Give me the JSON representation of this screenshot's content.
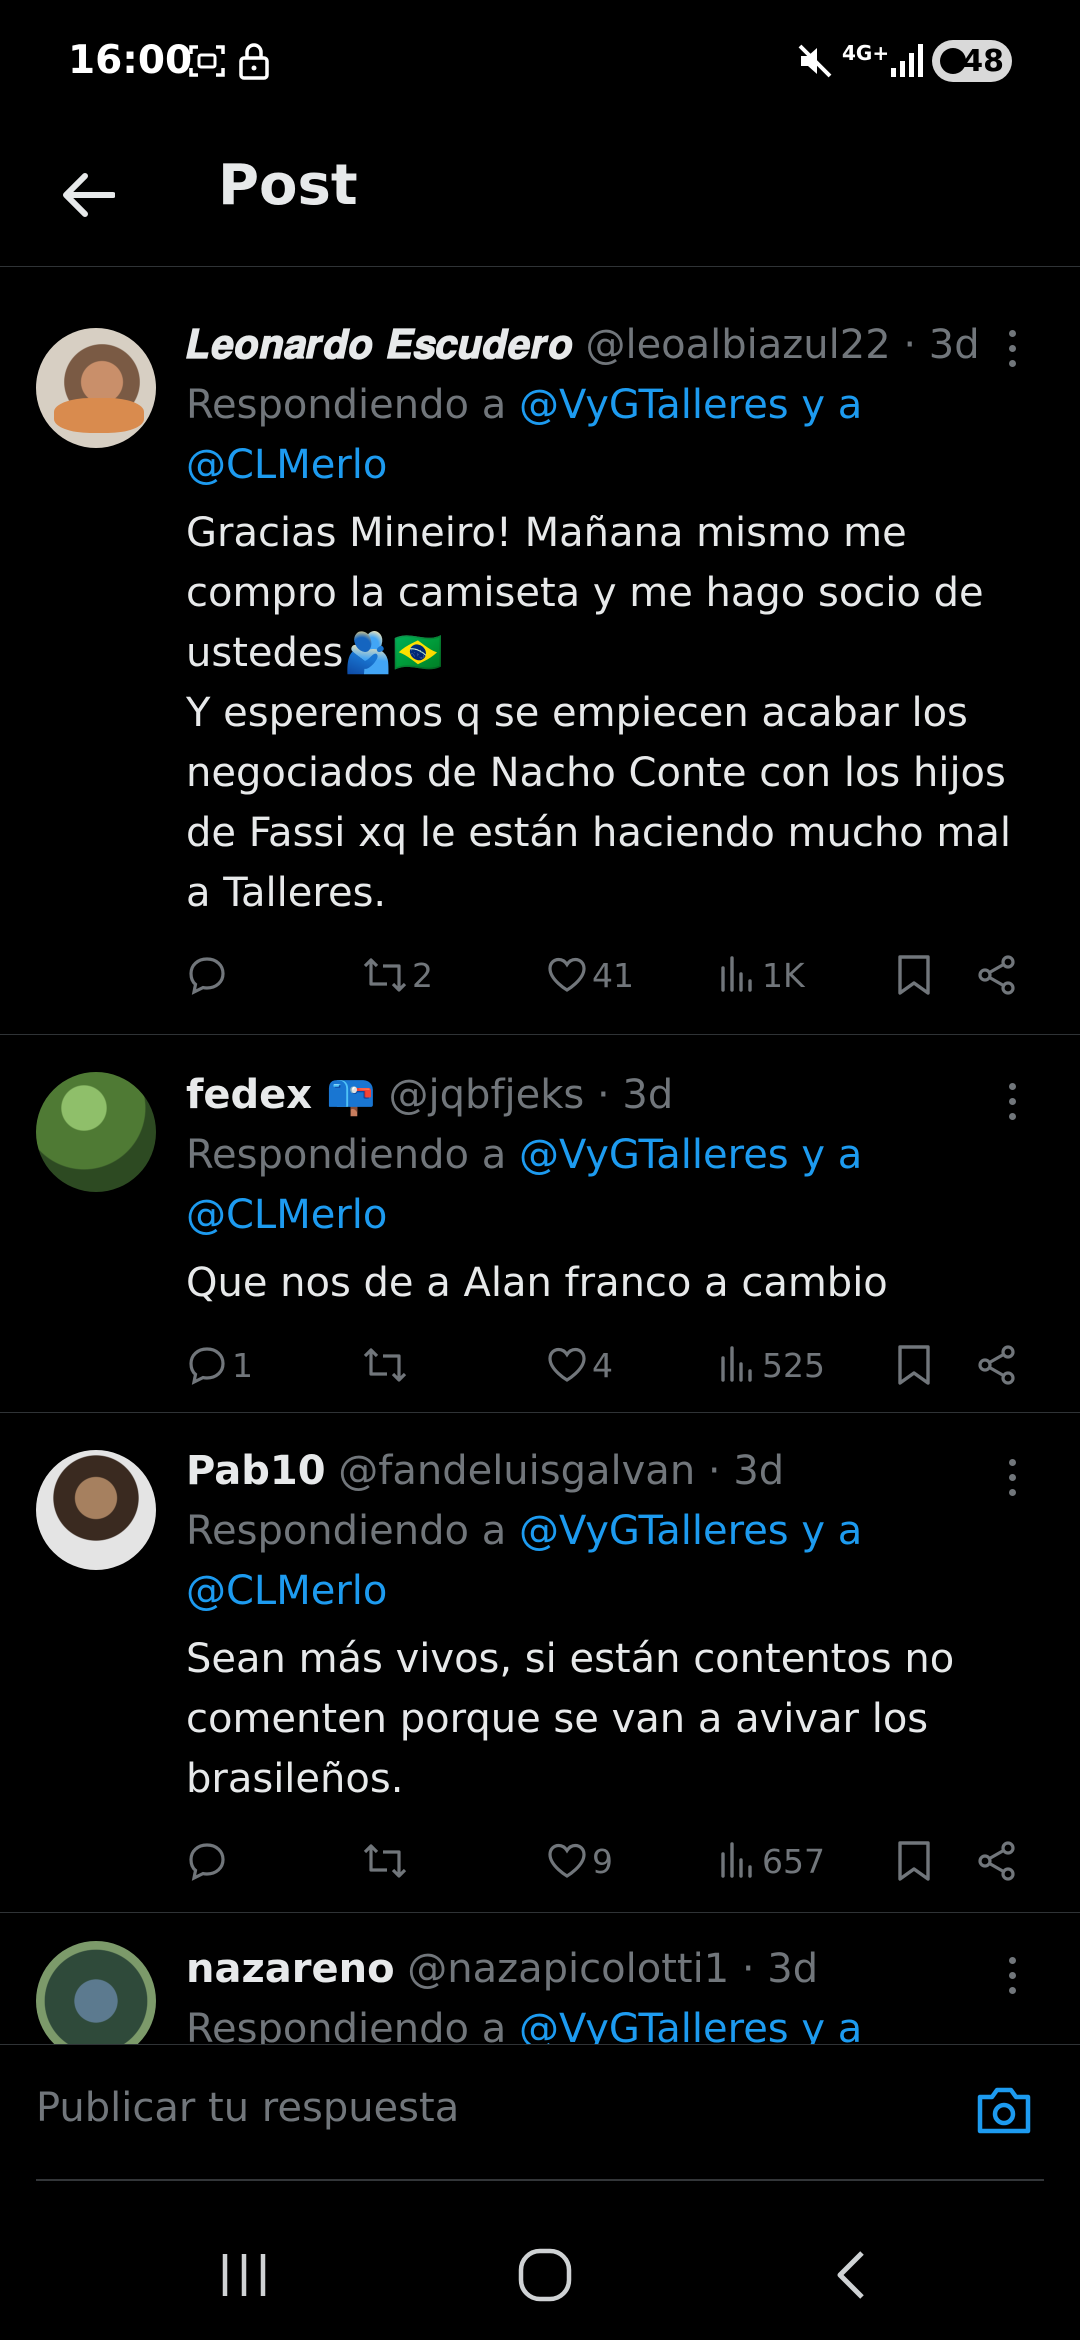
{
  "status_bar": {
    "time": "16:00",
    "network": "4G+",
    "battery": "48"
  },
  "header": {
    "title": "Post"
  },
  "tweets": [
    {
      "name": "𝑳𝒆𝒐𝒏𝒂𝒓𝒅𝒐 𝑬𝒔𝒄𝒖𝒅𝒆𝒓𝒐",
      "handle": "@leoalbiazul22",
      "time": "· 3d",
      "reply_prefix": "Respondiendo a ",
      "reply_to_1": "@VyGTalleres y a",
      "reply_to_2": "@CLMerlo",
      "text": "Gracias Mineiro! Mañana mismo me compro la camiseta y me hago socio de ustedes🫂🇧🇷\nY esperemos q se empiecen acabar los negociados de Nacho Conte con los hijos de Fassi xq le están haciendo mucho mal a Talleres.",
      "replies": "",
      "retweets": "2",
      "likes": "41",
      "views": "1K"
    },
    {
      "name": "fedex 📪",
      "handle": "@jqbfjeks",
      "time": "· 3d",
      "reply_prefix": "Respondiendo a ",
      "reply_to_1": "@VyGTalleres y a",
      "reply_to_2": "@CLMerlo",
      "text": "Que nos de a Alan franco a cambio",
      "replies": "1",
      "retweets": "",
      "likes": "4",
      "views": "525"
    },
    {
      "name": "Pab10",
      "handle": "@fandeluisgalvan",
      "time": "· 3d",
      "reply_prefix": "Respondiendo a ",
      "reply_to_1": "@VyGTalleres y a",
      "reply_to_2": "@CLMerlo",
      "text": "Sean más vivos, si están contentos no comenten porque se van a avivar los brasileños.",
      "replies": "",
      "retweets": "",
      "likes": "9",
      "views": "657"
    },
    {
      "name": "nazareno",
      "handle": "@nazapicolotti1",
      "time": "· 3d",
      "reply_prefix": "Respondiendo a ",
      "reply_to_1": "@VyGTalleres y a",
      "reply_to_2": "",
      "text": "",
      "replies": "",
      "retweets": "",
      "likes": "",
      "views": ""
    }
  ],
  "compose": {
    "placeholder": "Publicar tu respuesta"
  },
  "colors": {
    "background": "#000000",
    "text": "#e7e9ea",
    "muted": "#71767b",
    "accent": "#1d9bf0",
    "divider": "#2f3336"
  },
  "icons": {
    "status": [
      "screenshot-icon",
      "lock-icon",
      "mute-icon",
      "signal-icon",
      "battery-icon"
    ],
    "tweet_actions": [
      "reply-icon",
      "retweet-icon",
      "like-icon",
      "views-icon",
      "bookmark-icon",
      "share-icon"
    ],
    "nav": [
      "recents-icon",
      "home-icon",
      "back-icon"
    ]
  }
}
